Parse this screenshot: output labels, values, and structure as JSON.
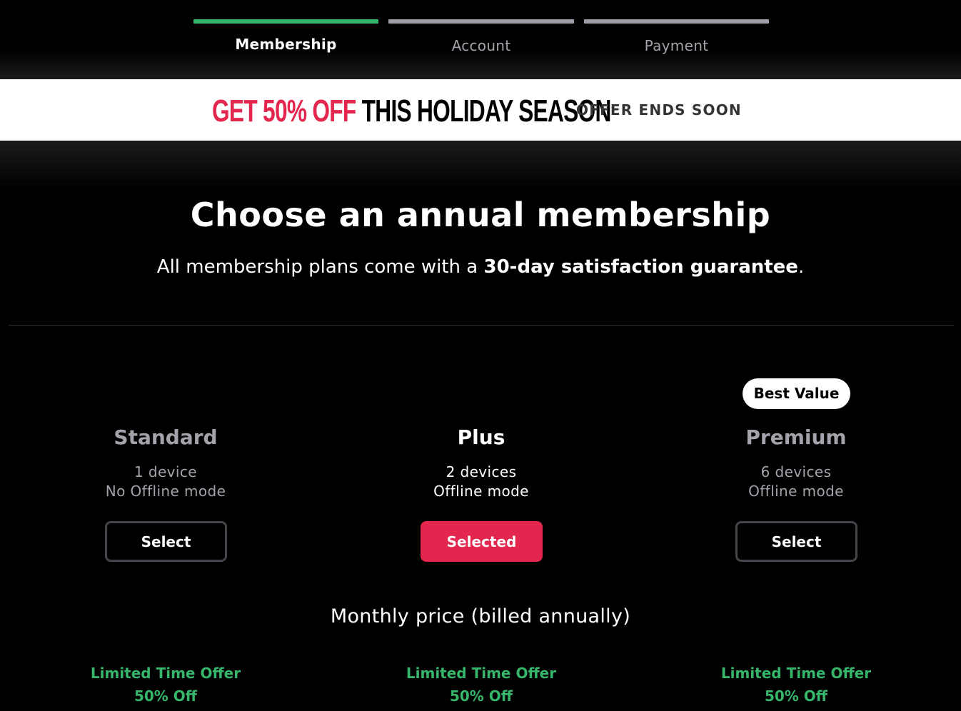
{
  "colors": {
    "accent": "#e2264d",
    "progress_active": "#36b56b",
    "progress_inactive": "#9e9ca6",
    "offer_text": "#36b56b"
  },
  "stepper": {
    "steps": [
      {
        "label": "Membership",
        "active": true
      },
      {
        "label": "Account",
        "active": false
      },
      {
        "label": "Payment",
        "active": false
      }
    ]
  },
  "promo": {
    "highlight": "GET 50% OFF",
    "rest": " THIS HOLIDAY SEASON",
    "ends": "OFFER ENDS SOON"
  },
  "main": {
    "title": "Choose an annual membership",
    "subtitle_prefix": "All membership plans come with a ",
    "subtitle_bold": "30-day satisfaction guarantee",
    "subtitle_suffix": "."
  },
  "plans": [
    {
      "name": "Standard",
      "features": [
        "1 device",
        "No Offline mode"
      ],
      "button_label": "Select",
      "selected": false,
      "badge": "",
      "offer_line1": "Limited Time Offer",
      "offer_line2": "50% Off"
    },
    {
      "name": "Plus",
      "features": [
        "2 devices",
        "Offline mode"
      ],
      "button_label": "Selected",
      "selected": true,
      "badge": "",
      "offer_line1": "Limited Time Offer",
      "offer_line2": "50% Off"
    },
    {
      "name": "Premium",
      "features": [
        "6 devices",
        "Offline mode"
      ],
      "button_label": "Select",
      "selected": false,
      "badge": "Best Value",
      "offer_line1": "Limited Time Offer",
      "offer_line2": "50% Off"
    }
  ],
  "pricing": {
    "heading": "Monthly price (billed annually)"
  }
}
